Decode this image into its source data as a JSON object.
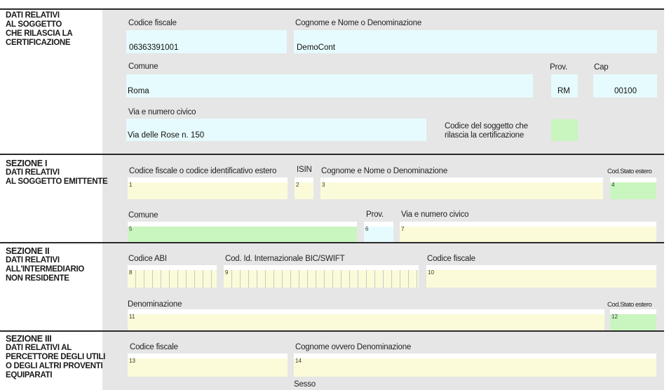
{
  "top_section": {
    "title_lines": [
      "DATI RELATIVI",
      "AL SOGGETTO",
      "CHE RILASCIA LA",
      "CERTIFICAZIONE"
    ],
    "codice_fiscale_label": "Codice fiscale",
    "codice_fiscale_value": "06363391001",
    "cognome_nome_label": "Cognome e Nome o Denominazione",
    "cognome_nome_value": "DemoCont",
    "comune_label": "Comune",
    "comune_value": "Roma",
    "prov_label": "Prov.",
    "prov_value": "RM",
    "cap_label": "Cap",
    "cap_value": "00100",
    "via_label": "Via e numero civico",
    "via_value": "Via delle Rose n. 150",
    "codice_soggetto_label_lines": [
      "Codice del soggetto che",
      "rilascia la certificazione"
    ]
  },
  "sezione1": {
    "title_big": "SEZIONE I",
    "title_lines": [
      "DATI RELATIVI",
      "AL SOGGETTO EMITTENTE"
    ],
    "codice_fiscale_estero_label": "Codice fiscale o codice identificativo estero",
    "isin_label": "ISIN",
    "cognome_nome_label": "Cognome e Nome o Denominazione",
    "cod_stato_estero_label": "Cod.Stato estero",
    "comune_label": "Comune",
    "prov_label": "Prov.",
    "via_label": "Via e numero civico",
    "field_numbers": [
      "1",
      "2",
      "3",
      "4",
      "5",
      "6",
      "7"
    ]
  },
  "sezione2": {
    "title_big": "SEZIONE II",
    "title_lines": [
      "DATI RELATIVI",
      "ALL'INTERMEDIARIO",
      "NON RESIDENTE"
    ],
    "abi_label": "Codice ABI",
    "bic_label": "Cod. Id. Internazionale BIC/SWIFT",
    "codice_fiscale_label": "Codice fiscale",
    "denominazione_label": "Denominazione",
    "cod_stato_estero_label": "Cod.Stato estero",
    "field_numbers": [
      "8",
      "9",
      "10",
      "11",
      "12"
    ]
  },
  "sezione3": {
    "title_big": "SEZIONE III",
    "title_lines": [
      "DATI RELATIVI AL",
      "PERCETTORE DEGLI UTILI",
      "O DEGLI ALTRI PROVENTI",
      "EQUIPARATI"
    ],
    "codice_fiscale_label": "Codice fiscale",
    "cognome_label": "Cognome ovvero Denominazione",
    "sesso_label": "Sesso",
    "field_numbers": [
      "13",
      "14"
    ]
  },
  "colors": {
    "panel": "#e6e6e6",
    "cyan_field": "#e6fbfd",
    "yellow_field": "#fbfbd9",
    "green_field": "#c9f5bf",
    "rule": "#2a2a2a"
  }
}
